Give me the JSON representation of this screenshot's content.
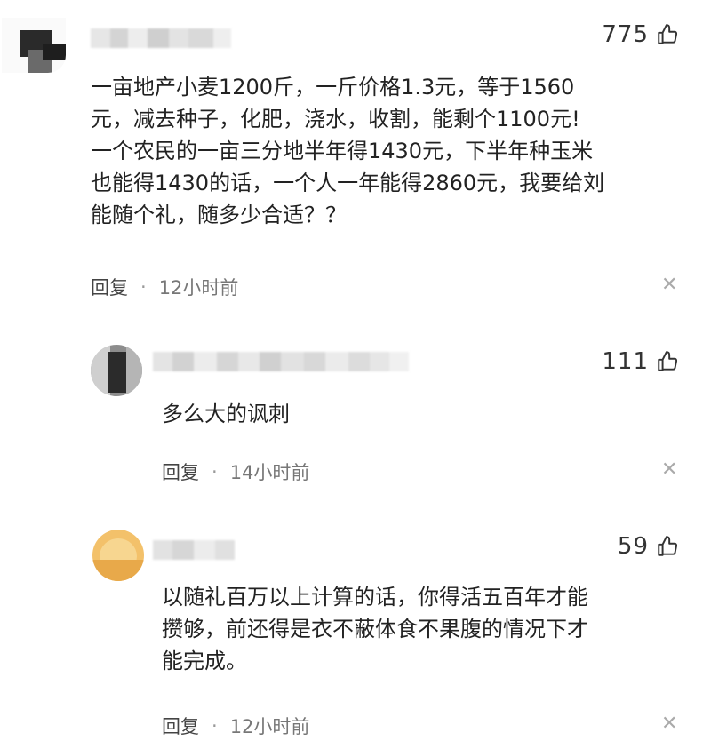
{
  "comments": [
    {
      "likes": "775",
      "text": "一亩地产小麦1200斤，一斤价格1.3元，等于1560\n元，减去种子，化肥，浇水，收割，能剩个1100元!\n一个农民的一亩三分地半年得1430元，下半年种玉米\n也能得1430的话，一个人一年能得2860元，我要给刘\n能随个礼，随多少合适？？",
      "reply_label": "回复",
      "time": "12小时前"
    },
    {
      "likes": "111",
      "text": "多么大的讽刺",
      "reply_label": "回复",
      "time": "14小时前"
    },
    {
      "likes": "59",
      "text": "以随礼百万以上计算的话，你得活五百年才能\n攒够，前还得是衣不蔽体食不果腹的情况下才\n能完成。",
      "reply_label": "回复",
      "time": "12小时前"
    }
  ],
  "icons": {
    "like": "thumbs-up-icon",
    "close": "close-icon"
  },
  "colors": {
    "text": "#222222",
    "meta": "#777777",
    "close": "#aaaaaa"
  }
}
